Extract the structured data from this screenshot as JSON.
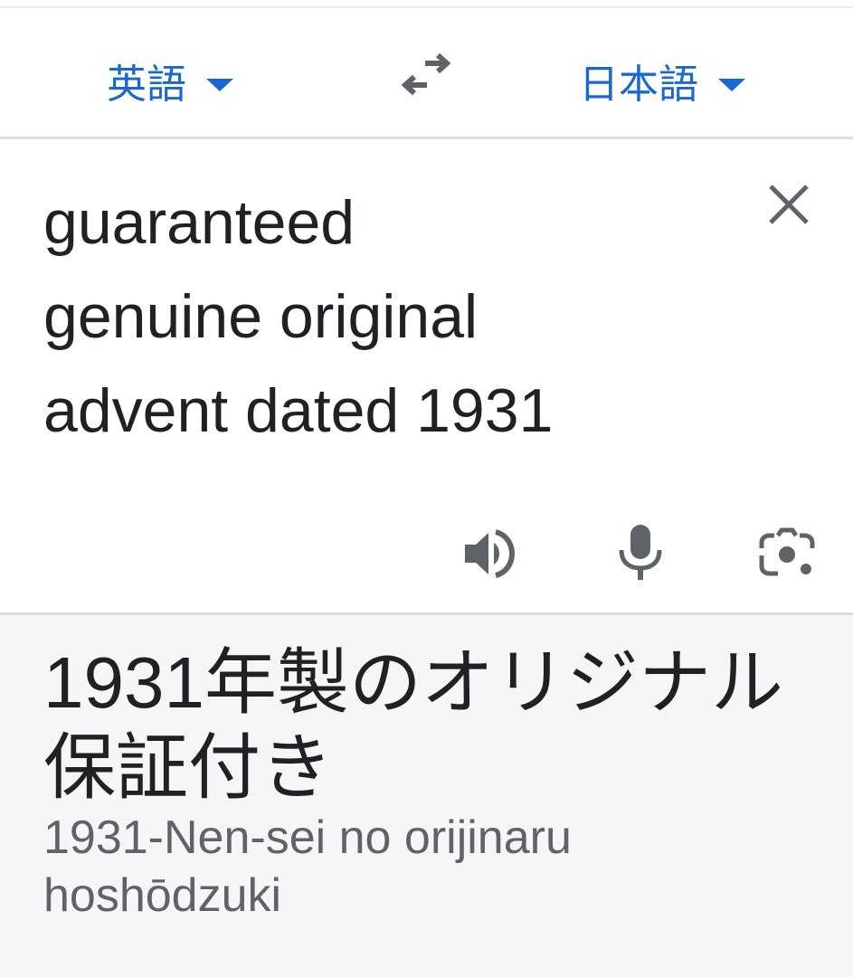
{
  "languages": {
    "source": "英語",
    "target": "日本語"
  },
  "input": {
    "text": "guaranteed\ngenuine original\nadvent dated 1931"
  },
  "output": {
    "translation": "1931年製のオリジナル\n保証付き",
    "romanization": "1931-Nen-sei no orijinaru\nhoshōdzuki"
  },
  "icons": {
    "swap": "swap-arrows-icon",
    "clear": "close-icon",
    "speaker": "speaker-icon",
    "mic": "microphone-icon",
    "camera": "camera-lens-icon"
  },
  "colors": {
    "accent": "#1967d2",
    "icon": "#5f6368",
    "result_background": "#f5f6f8"
  }
}
